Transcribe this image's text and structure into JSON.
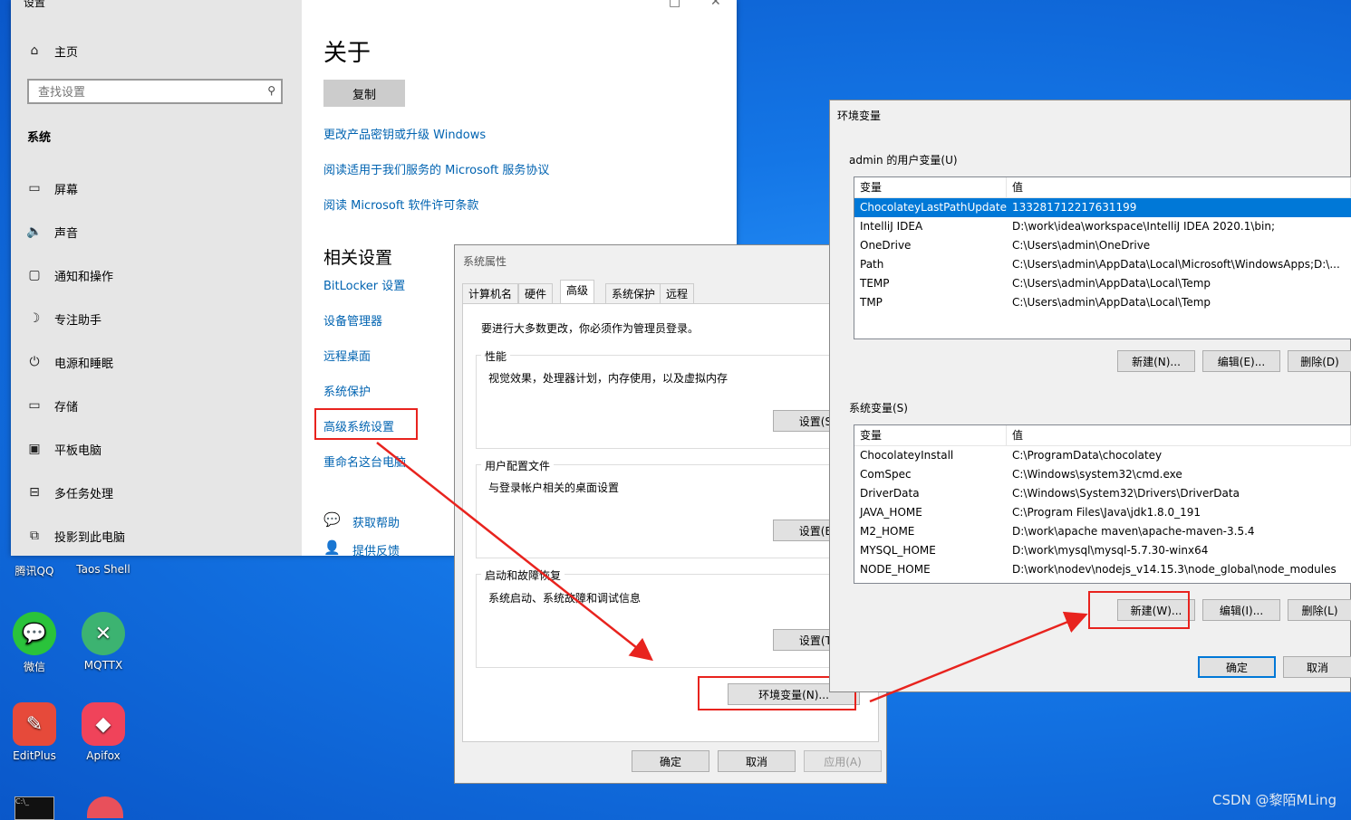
{
  "settings": {
    "title": "设置",
    "home": "主页",
    "search_placeholder": "查找设置",
    "section": "系统",
    "nav": [
      {
        "label": "屏幕",
        "icon": "monitor-icon"
      },
      {
        "label": "声音",
        "icon": "speaker-icon"
      },
      {
        "label": "通知和操作",
        "icon": "notification-icon"
      },
      {
        "label": "专注助手",
        "icon": "moon-icon"
      },
      {
        "label": "电源和睡眠",
        "icon": "power-icon"
      },
      {
        "label": "存储",
        "icon": "storage-icon"
      },
      {
        "label": "平板电脑",
        "icon": "tablet-icon"
      },
      {
        "label": "多任务处理",
        "icon": "multitask-icon"
      },
      {
        "label": "投影到此电脑",
        "icon": "project-icon"
      }
    ],
    "main": {
      "heading": "关于",
      "copy_button": "复制",
      "links": [
        "更改产品密钥或升级 Windows",
        "阅读适用于我们服务的 Microsoft 服务协议",
        "阅读 Microsoft 软件许可条款"
      ],
      "related_heading": "相关设置",
      "related": [
        "BitLocker 设置",
        "设备管理器",
        "远程桌面",
        "系统保护",
        "高级系统设置",
        "重命名这台电脑"
      ],
      "help": "获取帮助",
      "feedback": "提供反馈"
    }
  },
  "desktop_icons": [
    {
      "label": "腾讯QQ"
    },
    {
      "label": "Taos Shell"
    },
    {
      "label": "微信"
    },
    {
      "label": "MQTTX"
    },
    {
      "label": "EditPlus"
    },
    {
      "label": "Apifox"
    }
  ],
  "sysprop": {
    "title": "系统属性",
    "tabs": [
      "计算机名",
      "硬件",
      "高级",
      "系统保护",
      "远程"
    ],
    "admin_note": "要进行大多数更改，你必须作为管理员登录。",
    "perf": {
      "title": "性能",
      "desc": "视觉效果，处理器计划，内存使用，以及虚拟内存",
      "btn": "设置(S)..."
    },
    "profile": {
      "title": "用户配置文件",
      "desc": "与登录帐户相关的桌面设置",
      "btn": "设置(E)..."
    },
    "startup": {
      "title": "启动和故障恢复",
      "desc": "系统启动、系统故障和调试信息",
      "btn": "设置(T)..."
    },
    "env_btn": "环境变量(N)...",
    "ok": "确定",
    "cancel": "取消",
    "apply": "应用(A)"
  },
  "env": {
    "title": "环境变量",
    "user_label": "admin 的用户变量(U)",
    "col_var": "变量",
    "col_val": "值",
    "user_vars": [
      {
        "name": "ChocolateyLastPathUpdate",
        "value": "133281712217631199"
      },
      {
        "name": "IntelliJ IDEA",
        "value": "D:\\work\\idea\\workspace\\IntelliJ IDEA 2020.1\\bin;"
      },
      {
        "name": "OneDrive",
        "value": "C:\\Users\\admin\\OneDrive"
      },
      {
        "name": "Path",
        "value": "C:\\Users\\admin\\AppData\\Local\\Microsoft\\WindowsApps;D:\\..."
      },
      {
        "name": "TEMP",
        "value": "C:\\Users\\admin\\AppData\\Local\\Temp"
      },
      {
        "name": "TMP",
        "value": "C:\\Users\\admin\\AppData\\Local\\Temp"
      }
    ],
    "user_btns": [
      "新建(N)...",
      "编辑(E)...",
      "删除(D)"
    ],
    "sys_label": "系统变量(S)",
    "sys_vars": [
      {
        "name": "ChocolateyInstall",
        "value": "C:\\ProgramData\\chocolatey"
      },
      {
        "name": "ComSpec",
        "value": "C:\\Windows\\system32\\cmd.exe"
      },
      {
        "name": "DriverData",
        "value": "C:\\Windows\\System32\\Drivers\\DriverData"
      },
      {
        "name": "JAVA_HOME",
        "value": "C:\\Program Files\\Java\\jdk1.8.0_191"
      },
      {
        "name": "M2_HOME",
        "value": "D:\\work\\apache maven\\apache-maven-3.5.4"
      },
      {
        "name": "MYSQL_HOME",
        "value": "D:\\work\\mysql\\mysql-5.7.30-winx64"
      },
      {
        "name": "NODE_HOME",
        "value": "D:\\work\\nodev\\nodejs_v14.15.3\\node_global\\node_modules"
      }
    ],
    "sys_btns": [
      "新建(W)...",
      "编辑(I)...",
      "删除(L)"
    ],
    "ok": "确定",
    "cancel": "取消"
  },
  "watermark": "CSDN @黎陌MLing",
  "colors": {
    "annotation_red": "#e8231e",
    "link_blue": "#0063b1",
    "selection_blue": "#0078d7"
  }
}
